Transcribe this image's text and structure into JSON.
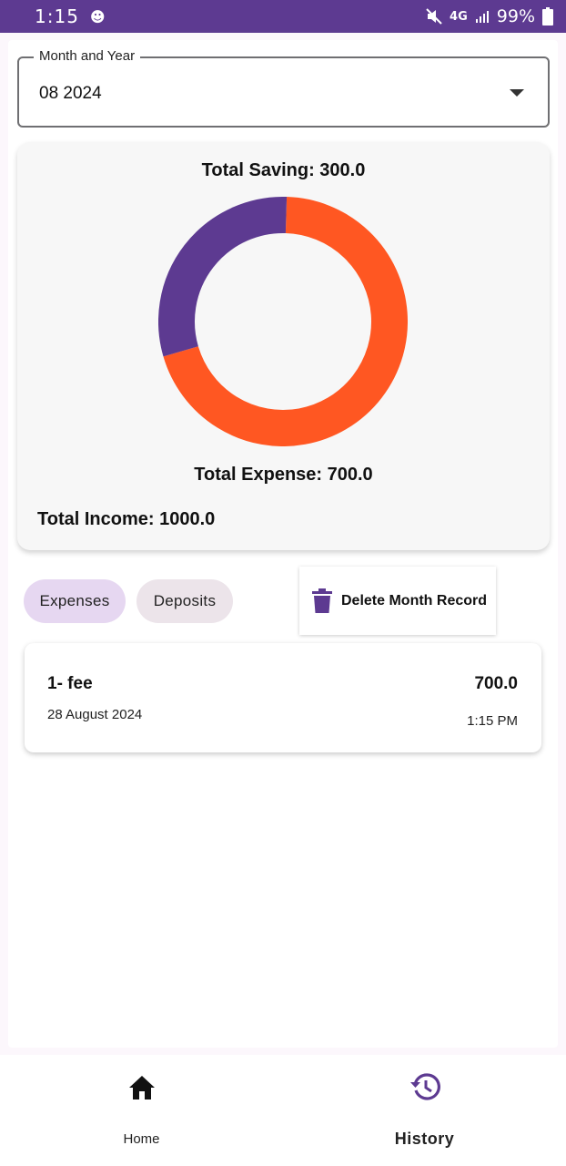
{
  "status_bar": {
    "time": "1:15",
    "network": "4G",
    "battery": "99%",
    "icons": [
      "app-notification-icon",
      "mute-icon",
      "network-icon",
      "signal-icon",
      "battery-icon"
    ]
  },
  "month_selector": {
    "label": "Month and Year",
    "value": "08 2024"
  },
  "summary": {
    "saving_text": "Total Saving: 300.0",
    "expense_text": "Total Expense: 700.0",
    "income_text": "Total Income: 1000.0",
    "colors": {
      "saving": "#5d3a91",
      "expense": "#ff5722"
    }
  },
  "chart_data": {
    "type": "pie",
    "donut": true,
    "series": [
      {
        "name": "Saving",
        "value": 300.0,
        "color": "#5d3a91"
      },
      {
        "name": "Expense",
        "value": 700.0,
        "color": "#ff5722"
      }
    ]
  },
  "filters": {
    "expenses_label": "Expenses",
    "deposits_label": "Deposits",
    "selected": "Expenses"
  },
  "delete_button": {
    "label": "Delete Month Record",
    "icon": "trash-icon"
  },
  "records": [
    {
      "title": "1- fee",
      "date": "28 August 2024",
      "amount": "700.0",
      "time": "1:15 PM"
    }
  ],
  "bottom_nav": {
    "home_label": "Home",
    "history_label": "History",
    "active": "History",
    "active_color": "#5d3a91"
  }
}
